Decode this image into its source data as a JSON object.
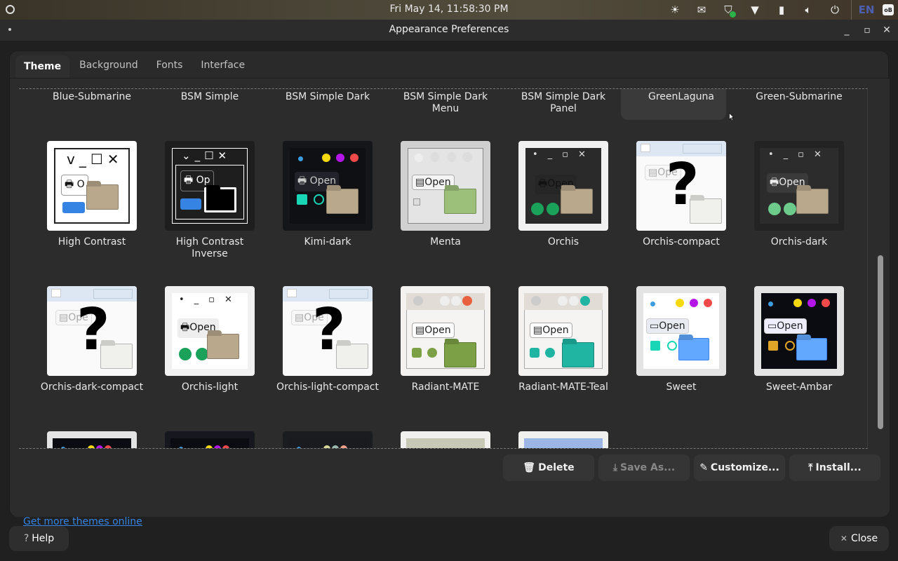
{
  "topbar": {
    "clock": "Fri May 14, 11:58:30 PM",
    "tray_icons": [
      "brightness-icon",
      "mail-icon",
      "shield-check-icon",
      "wifi-icon",
      "battery-icon",
      "volume-icon",
      "power-icon"
    ],
    "language": "EN",
    "keyboard_badge": "oB"
  },
  "window": {
    "title": "Appearance Preferences",
    "controls": {
      "minimize": "_",
      "maximize": "▫",
      "close": "✕"
    }
  },
  "tabs": [
    {
      "label": "Theme",
      "active": true
    },
    {
      "label": "Background",
      "active": false
    },
    {
      "label": "Fonts",
      "active": false
    },
    {
      "label": "Interface",
      "active": false
    }
  ],
  "themes_partial_row": [
    {
      "name": "Blue-Submarine"
    },
    {
      "name": "BSM Simple"
    },
    {
      "name": "BSM Simple Dark"
    },
    {
      "name": "BSM Simple Dark Menu"
    },
    {
      "name": "BSM Simple Dark Panel"
    },
    {
      "name": "GreenLaguna",
      "selected": true
    },
    {
      "name": "Green-Submarine"
    }
  ],
  "themes": [
    {
      "name": "High Contrast",
      "style": "hc"
    },
    {
      "name": "High Contrast Inverse",
      "style": "hci"
    },
    {
      "name": "Kimi-dark",
      "style": "kimi"
    },
    {
      "name": "Menta",
      "style": "menta"
    },
    {
      "name": "Orchis",
      "style": "orchis"
    },
    {
      "name": "Orchis-compact",
      "style": "missing"
    },
    {
      "name": "Orchis-dark",
      "style": "orchisdark"
    },
    {
      "name": "Orchis-dark-compact",
      "style": "missing"
    },
    {
      "name": "Orchis-light",
      "style": "orchislight"
    },
    {
      "name": "Orchis-light-compact",
      "style": "missing"
    },
    {
      "name": "Radiant-MATE",
      "style": "radiant"
    },
    {
      "name": "Radiant-MATE-Teal",
      "style": "radiantteal"
    },
    {
      "name": "Sweet",
      "style": "sweet"
    },
    {
      "name": "Sweet-Ambar",
      "style": "sweetambar"
    }
  ],
  "themes_cutoff_row": [
    {
      "style": "sweet-a"
    },
    {
      "style": "sweet-b"
    },
    {
      "style": "sweet-c"
    },
    {
      "style": "traditional-a"
    },
    {
      "style": "traditional-b"
    }
  ],
  "preview_text": {
    "open": "Open",
    "missing": "?"
  },
  "actions": [
    {
      "label": "Delete",
      "icon": "trash-icon",
      "enabled": true
    },
    {
      "label": "Save As...",
      "icon": "save-icon",
      "enabled": false
    },
    {
      "label": "Customize...",
      "icon": "pencil-icon",
      "enabled": true
    },
    {
      "label": "Install...",
      "icon": "upload-icon",
      "enabled": true
    }
  ],
  "link": "Get more themes online",
  "footer": {
    "help": "Help",
    "close": "Close"
  },
  "colors": {
    "accent": "#3584e4",
    "background": "#2c2c2c",
    "selected": "#3a3a3a"
  }
}
